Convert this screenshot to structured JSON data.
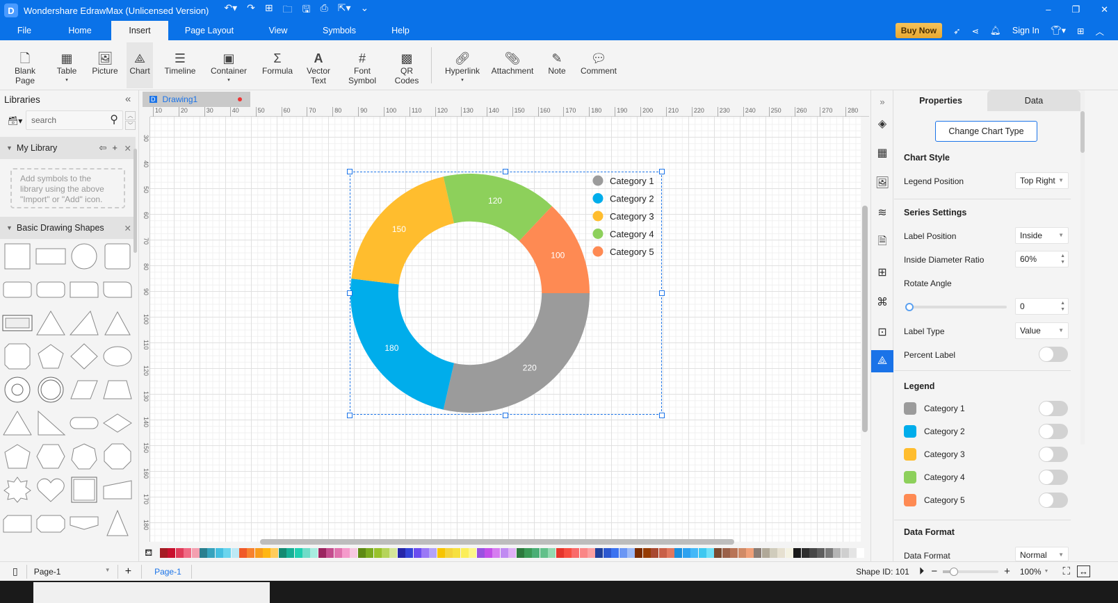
{
  "app": {
    "title": "Wondershare EdrawMax (Unlicensed Version)",
    "logo_glyph": "D"
  },
  "quick_access": [
    "undo-icon",
    "redo-icon",
    "new-icon",
    "open-icon",
    "save-icon",
    "print-icon",
    "export-icon",
    "customize-icon"
  ],
  "window_controls": {
    "minimize": "–",
    "restore": "❐",
    "close": "✕"
  },
  "menu": {
    "items": [
      "File",
      "Home",
      "Insert",
      "Page Layout",
      "View",
      "Symbols",
      "Help"
    ],
    "active": "Insert"
  },
  "menu_right": {
    "buy_now": "Buy Now",
    "sign_in": "Sign In"
  },
  "ribbon": {
    "items": [
      {
        "label": "Blank\nPage",
        "icon": "blank-page-icon",
        "has_dropdown": true
      },
      {
        "label": "Table",
        "icon": "table-icon",
        "has_dropdown": true
      },
      {
        "label": "Picture",
        "icon": "picture-icon"
      },
      {
        "label": "Chart",
        "icon": "chart-icon",
        "active": true
      },
      {
        "label": "Timeline",
        "icon": "timeline-icon"
      },
      {
        "label": "Container",
        "icon": "container-icon",
        "has_dropdown": true
      },
      {
        "label": "Formula",
        "icon": "formula-icon"
      },
      {
        "label": "Vector\nText",
        "icon": "vector-text-icon"
      },
      {
        "label": "Font\nSymbol",
        "icon": "font-symbol-icon",
        "has_dropdown": true
      },
      {
        "label": "QR\nCodes",
        "icon": "qr-code-icon"
      },
      {
        "label": "Hyperlink",
        "icon": "hyperlink-icon",
        "has_dropdown": true
      },
      {
        "label": "Attachment",
        "icon": "attachment-icon"
      },
      {
        "label": "Note",
        "icon": "note-icon"
      },
      {
        "label": "Comment",
        "icon": "comment-icon"
      }
    ]
  },
  "libraries": {
    "title": "Libraries",
    "search_placeholder": "search",
    "my_library": {
      "title": "My Library",
      "hint": "Add symbols to the library using the above \"Import\" or \"Add\" icon."
    },
    "basic_shapes": {
      "title": "Basic Drawing Shapes"
    }
  },
  "document": {
    "tab": "Drawing1",
    "unsaved": true
  },
  "rulers": {
    "h": [
      "10",
      "20",
      "30",
      "40",
      "50",
      "60",
      "70",
      "80",
      "90",
      "100",
      "110",
      "120",
      "130",
      "140",
      "150",
      "160",
      "170",
      "180",
      "190",
      "200",
      "210",
      "220",
      "230",
      "240",
      "250",
      "260",
      "270",
      "280"
    ],
    "v": [
      "30",
      "40",
      "50",
      "60",
      "70",
      "80",
      "90",
      "100",
      "110",
      "120",
      "130",
      "140",
      "150",
      "160",
      "170",
      "180"
    ]
  },
  "palette": [
    "#a51c24",
    "#c8102e",
    "#e03c5a",
    "#f06b85",
    "#f4a0b0",
    "#2a7f8f",
    "#36a3bd",
    "#44bfe0",
    "#6ad5ee",
    "#bde9f5",
    "#f05a28",
    "#f7822f",
    "#f99c1c",
    "#ffb612",
    "#ffcc5c",
    "#138a72",
    "#16b096",
    "#1fcfb0",
    "#6fdcc8",
    "#a8ece0",
    "#9b2560",
    "#c44d8e",
    "#e072ad",
    "#f59acb",
    "#f6c8e0",
    "#5e8a14",
    "#7aab20",
    "#98c22c",
    "#b5d45a",
    "#d4e59a",
    "#2526a8",
    "#3343d8",
    "#6a4df0",
    "#9a78f6",
    "#b4a2f8",
    "#f7c400",
    "#f4d43a",
    "#f6e03e",
    "#fbee58",
    "#fcf68a",
    "#9a52e0",
    "#c24fe8",
    "#d67cf0",
    "#c08af2",
    "#deb0f5",
    "#2d7a3e",
    "#3a9a56",
    "#4aae75",
    "#62c08a",
    "#94d9b0",
    "#e5352c",
    "#f74d40",
    "#f96a6a",
    "#fa8686",
    "#fba0a0",
    "#20409a",
    "#2c58d0",
    "#3a72f0",
    "#6a96f4",
    "#9cbaf6",
    "#7a2c00",
    "#963c04",
    "#a84830",
    "#c86048",
    "#e0785e",
    "#1a8edc",
    "#2ea2f0",
    "#44b8f8",
    "#3ec8f0",
    "#6ee0f8",
    "#7a4a30",
    "#9a6048",
    "#b87456",
    "#d08a66",
    "#f0a078",
    "#8a7c74",
    "#b0a898",
    "#d0ccbc",
    "#e6e0d0",
    "#f4f2e2",
    "#1a1a1a",
    "#2e2e2e",
    "#464646",
    "#5e5e5e",
    "#7a7a7a",
    "#b4b4b4",
    "#cfcfcf",
    "#e4e4e4",
    "#ffffff"
  ],
  "chart_data": {
    "type": "pie",
    "variant": "donut",
    "title": "",
    "categories": [
      "Category 1",
      "Category 2",
      "Category 3",
      "Category 4",
      "Category 5"
    ],
    "values": [
      220,
      180,
      150,
      120,
      100
    ],
    "colors": [
      "#9b9b9b",
      "#00adeb",
      "#ffbd2e",
      "#8dd05b",
      "#fe8a53"
    ],
    "inner_diameter_ratio": 0.6,
    "rotate_angle": 0,
    "start": "3 o'clock, clockwise",
    "label_position": "inside",
    "label_type": "value",
    "legend_position": "top-right"
  },
  "side_icons": [
    "fill-icon",
    "grid-icon",
    "image-icon",
    "layers-icon",
    "page-icon",
    "outline-icon",
    "mind-map-icon",
    "presentation-icon",
    "chart-icon"
  ],
  "properties": {
    "tabs": [
      "Properties",
      "Data"
    ],
    "active_tab": "Properties",
    "change_chart_type": "Change Chart Type",
    "chart_style": {
      "heading": "Chart Style",
      "legend_position_label": "Legend Position",
      "legend_position_value": "Top Right"
    },
    "series_settings": {
      "heading": "Series Settings",
      "label_position_label": "Label Position",
      "label_position_value": "Inside",
      "inside_ratio_label": "Inside Diameter Ratio",
      "inside_ratio_value": "60%",
      "rotate_label": "Rotate Angle",
      "rotate_value": "0",
      "rotate_fraction": 0,
      "label_type_label": "Label Type",
      "label_type_value": "Value",
      "percent_label": "Percent Label",
      "percent_label_on": false
    },
    "legend": {
      "heading": "Legend",
      "items": [
        "Category 1",
        "Category 2",
        "Category 3",
        "Category 4",
        "Category 5"
      ]
    },
    "data_format": {
      "heading": "Data Format",
      "label": "Data Format",
      "value": "Normal"
    }
  },
  "status": {
    "page_select": "Page-1",
    "page_tab": "Page-1",
    "shape_id": "Shape ID: 101",
    "zoom": "100%",
    "zoom_fraction": 0.2
  }
}
